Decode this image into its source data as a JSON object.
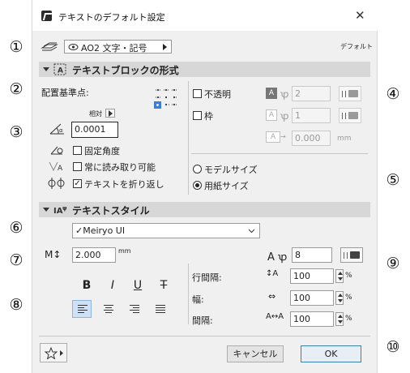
{
  "callouts": [
    "①",
    "②",
    "③",
    "④",
    "⑤",
    "⑥",
    "⑦",
    "⑧",
    "⑨",
    "⑩"
  ],
  "window": {
    "title": "テキストのデフォルト設定",
    "close_icon": "close-icon"
  },
  "top": {
    "layer": "AO2 文字・記号",
    "default_label": "デフォルト"
  },
  "text_block": {
    "header": "テキストブロックの形式",
    "anchor_label": "配置基準点:",
    "relative_label": "相対",
    "rotation_value": "0.0001",
    "fixed_angle": "固定角度",
    "always_readable": "常に読み取り可能",
    "wrap_text": "テキストを折り返し",
    "opaque": "不透明",
    "opaque_pen": "2",
    "frame": "枠",
    "frame_pen": "1",
    "frame_offset": "0.000",
    "frame_unit": "mm",
    "model_size": "モデルサイズ",
    "paper_size": "用紙サイズ"
  },
  "text_style": {
    "header": "テキストスタイル",
    "font": "✓Meiryo UI",
    "size_value": "2.000",
    "size_unit": "mm",
    "pen_value": "8",
    "bold": "B",
    "italic": "I",
    "underline": "U",
    "strike": "T",
    "line_spacing_label": "行間隔:",
    "line_spacing_value": "100",
    "width_label": "幅:",
    "width_value": "100",
    "spacing_label": "間隔:",
    "spacing_value": "100",
    "percent": "%"
  },
  "footer": {
    "cancel": "キャンセル",
    "ok": "OK"
  }
}
